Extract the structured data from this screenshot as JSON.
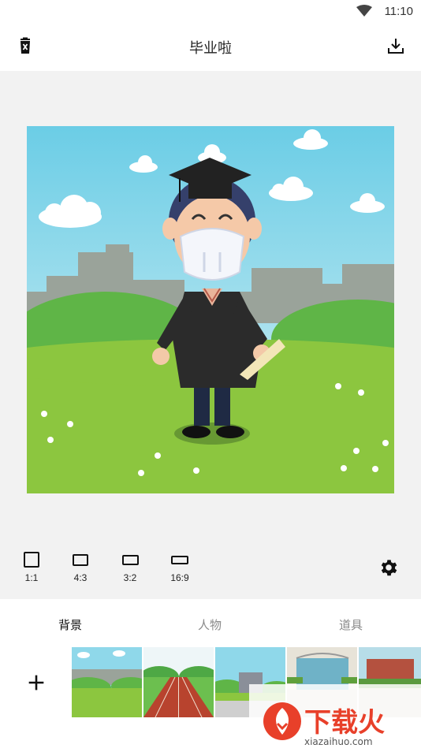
{
  "status": {
    "time": "11:10",
    "wifi_icon": "wifi-icon"
  },
  "appbar": {
    "title": "毕业啦",
    "delete_icon": "delete-icon",
    "download_icon": "download-icon"
  },
  "ratios": [
    {
      "label": "1:1"
    },
    {
      "label": "4:3"
    },
    {
      "label": "3:2"
    },
    {
      "label": "16:9"
    }
  ],
  "settings_icon": "gear-icon",
  "tabs": [
    {
      "label": "背景",
      "active": true
    },
    {
      "label": "人物",
      "active": false
    },
    {
      "label": "道具",
      "active": false
    }
  ],
  "add_icon": "plus-icon",
  "thumbnails": [
    "background-park",
    "background-running-track",
    "background-school-building",
    "background-glass-building",
    "background-campus"
  ],
  "watermark": {
    "brand": "下载火",
    "url": "xiazaihuo.com"
  },
  "colors": {
    "sky": "#6fd0e6",
    "grass": "#8cc63f",
    "gown": "#2b2b2b",
    "brand": "#e8402a"
  }
}
